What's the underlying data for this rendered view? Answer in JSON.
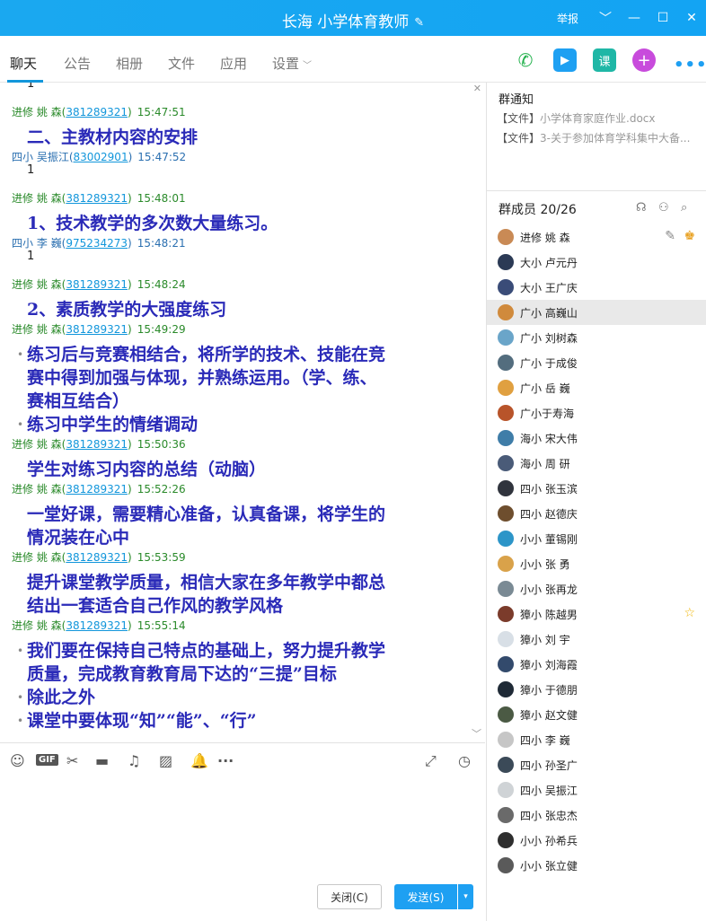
{
  "window": {
    "title": "长海 小学体育教师",
    "report": "举报",
    "controls": [
      "﹀",
      "—",
      "☐",
      "✕"
    ]
  },
  "tabs": [
    "聊天",
    "公告",
    "相册",
    "文件",
    "应用",
    "设置"
  ],
  "colors": {
    "accent": "#1296db",
    "message_text": "#2a2ab8",
    "titlebar": "#1aa8f0"
  },
  "messages": [
    {
      "kind": "text",
      "text": "1"
    },
    {
      "kind": "hdr",
      "sender": "进修 姚  森",
      "qq": "381289321",
      "time": "15:47:51"
    },
    {
      "kind": "body",
      "text": "二、主教材内容的安排"
    },
    {
      "kind": "hdr",
      "sender": "四小 吴振江",
      "qq": "83002901",
      "time": "15:47:52",
      "other": true
    },
    {
      "kind": "text",
      "text": "1"
    },
    {
      "kind": "hdr",
      "sender": "进修 姚  森",
      "qq": "381289321",
      "time": "15:48:01"
    },
    {
      "kind": "body",
      "text": "1、技术教学的多次数大量练习。"
    },
    {
      "kind": "hdr",
      "sender": "四小 李  巍",
      "qq": "975234273",
      "time": "15:48:21",
      "other": true
    },
    {
      "kind": "text",
      "text": "1"
    },
    {
      "kind": "hdr",
      "sender": "进修 姚  森",
      "qq": "381289321",
      "time": "15:48:24"
    },
    {
      "kind": "body",
      "text": "2、素质教学的大强度练习"
    },
    {
      "kind": "hdr",
      "sender": "进修 姚  森",
      "qq": "381289321",
      "time": "15:49:29"
    },
    {
      "kind": "body",
      "bullet": true,
      "text": "练习后与竞赛相结合，将所学的技术、技能在竞"
    },
    {
      "kind": "body",
      "text": "赛中得到加强与体现，并熟练运用。（学、练、"
    },
    {
      "kind": "body",
      "text": "赛相互结合）"
    },
    {
      "kind": "body",
      "bullet": true,
      "text": "练习中学生的情绪调动"
    },
    {
      "kind": "hdr",
      "sender": "进修 姚  森",
      "qq": "381289321",
      "time": "15:50:36"
    },
    {
      "kind": "body",
      "text": "学生对练习内容的总结（动脑）"
    },
    {
      "kind": "hdr",
      "sender": "进修 姚  森",
      "qq": "381289321",
      "time": "15:52:26"
    },
    {
      "kind": "body",
      "text": "一堂好课，需要精心准备，认真备课，将学生的"
    },
    {
      "kind": "body",
      "text": "情况装在心中"
    },
    {
      "kind": "hdr",
      "sender": "进修 姚  森",
      "qq": "381289321",
      "time": "15:53:59"
    },
    {
      "kind": "body",
      "text": "提升课堂教学质量，相信大家在多年教学中都总"
    },
    {
      "kind": "body",
      "text": "结出一套适合自己作风的教学风格"
    },
    {
      "kind": "hdr",
      "sender": "进修 姚  森",
      "qq": "381289321",
      "time": "15:55:14"
    },
    {
      "kind": "body",
      "bullet": true,
      "text": "我们要在保持自己特点的基础上，努力提升教学"
    },
    {
      "kind": "body",
      "text": "质量，完成教育教育局下达的“三提”目标"
    },
    {
      "kind": "body",
      "bullet": true,
      "text": "除此之外"
    },
    {
      "kind": "body",
      "bullet": true,
      "text": "课堂中要体现“知”“能”、“行”"
    }
  ],
  "input_toolbar_icons": [
    "emoji-icon",
    "gif-icon",
    "scissors-icon",
    "folder-icon",
    "music-icon",
    "image-icon",
    "bell-icon",
    "more-icon",
    "expand-icon",
    "history-icon"
  ],
  "buttons": {
    "close": "关闭(C)",
    "send": "发送(S)",
    "send_dropdown": "▾"
  },
  "notice": {
    "title": "群通知",
    "files": [
      {
        "tag": "【文件】",
        "name": "小学体育家庭作业.docx"
      },
      {
        "tag": "【文件】",
        "name": "3-关于参加体育学科集中大备..."
      }
    ]
  },
  "members": {
    "title": "群成员 20/26",
    "list": [
      {
        "name": "进修 姚  森",
        "color": "#c98a55",
        "badge": "owner"
      },
      {
        "name": "大小 卢元丹",
        "color": "#2b3a55"
      },
      {
        "name": "大小 王广庆",
        "color": "#3a4c78"
      },
      {
        "name": "广小 高巍山",
        "color": "#d08a3c",
        "selected": true
      },
      {
        "name": "广小 刘树森",
        "color": "#6aa5c9"
      },
      {
        "name": "广小 于成俊",
        "color": "#536d7e"
      },
      {
        "name": "广小 岳  巍",
        "color": "#e0a040"
      },
      {
        "name": "广小于寿海",
        "color": "#b8542a"
      },
      {
        "name": "海小 宋大伟",
        "color": "#3f7da8"
      },
      {
        "name": "海小 周  研",
        "color": "#4a5b78"
      },
      {
        "name": "四小 张玉滨",
        "color": "#30343d"
      },
      {
        "name": "四小 赵德庆",
        "color": "#6e4e2e"
      },
      {
        "name": "小小 董锡刚",
        "color": "#2c95c8"
      },
      {
        "name": "小小 张  勇",
        "color": "#d9a24a"
      },
      {
        "name": "小小 张再龙",
        "color": "#7a8a94"
      },
      {
        "name": "獐小 陈越男",
        "color": "#7b3b2b",
        "badge": "star"
      },
      {
        "name": "獐小 刘  宇",
        "color": "#d8dfe6"
      },
      {
        "name": "獐小 刘海霞",
        "color": "#334a6c"
      },
      {
        "name": "獐小 于德朋",
        "color": "#1f2a36"
      },
      {
        "name": "獐小 赵文健",
        "color": "#4b5a44"
      },
      {
        "name": "四小 李  巍",
        "color": "#c6c6c6"
      },
      {
        "name": "四小 孙圣广",
        "color": "#3b4a58"
      },
      {
        "name": "四小 吴振江",
        "color": "#cfd3d6"
      },
      {
        "name": "四小 张忠杰",
        "color": "#6a6a6a"
      },
      {
        "name": "小小 孙希兵",
        "color": "#2e2e2e"
      },
      {
        "name": "小小 张立健",
        "color": "#5a5a5a"
      }
    ]
  }
}
